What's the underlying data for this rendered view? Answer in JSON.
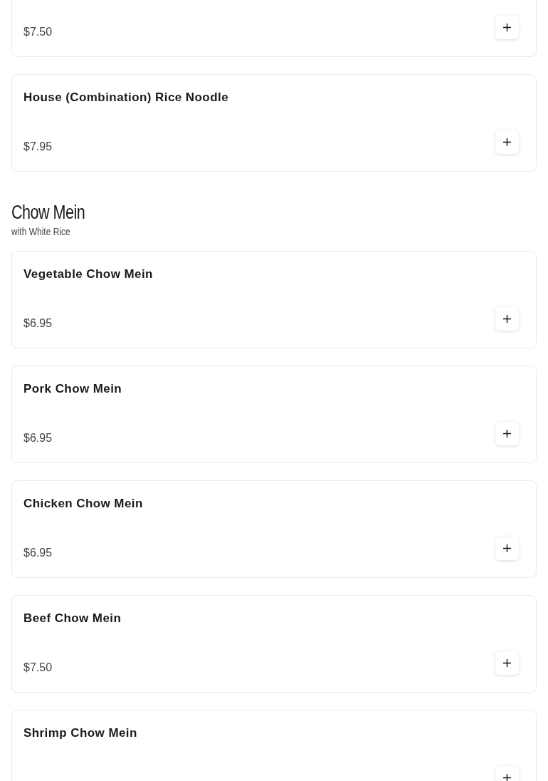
{
  "sections": [
    {
      "items": [
        {
          "price": "$7.50"
        },
        {
          "name": "House (Combination) Rice Noodle",
          "price": "$7.95"
        }
      ]
    },
    {
      "title": "Chow Mein",
      "subtitle": "with White Rice",
      "items": [
        {
          "name": "Vegetable Chow Mein",
          "price": "$6.95"
        },
        {
          "name": "Pork Chow Mein",
          "price": "$6.95"
        },
        {
          "name": "Chicken Chow Mein",
          "price": "$6.95"
        },
        {
          "name": "Beef Chow Mein",
          "price": "$7.50"
        },
        {
          "name": "Shrimp Chow Mein"
        }
      ]
    }
  ]
}
